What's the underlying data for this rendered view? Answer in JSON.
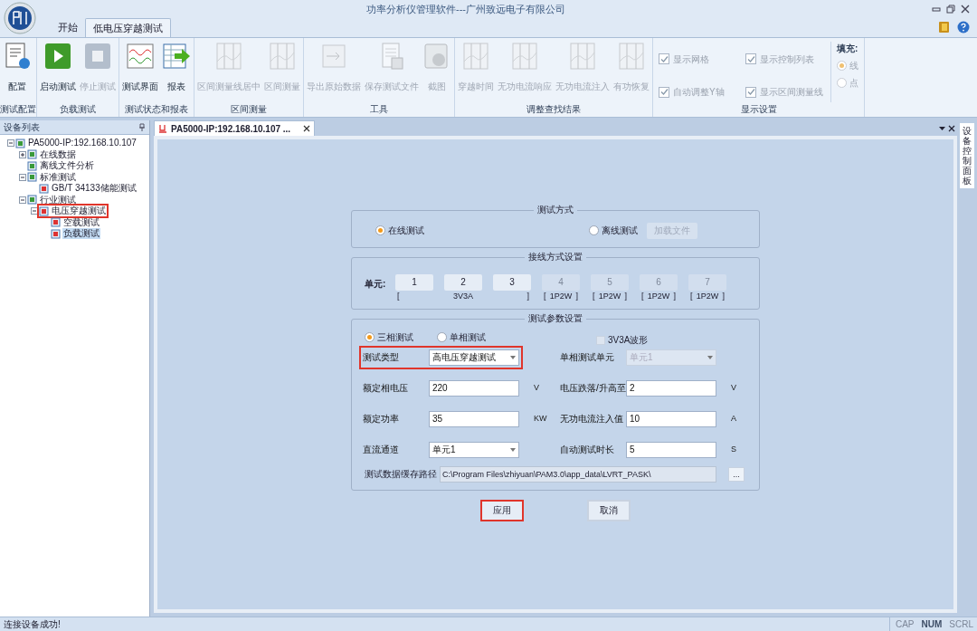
{
  "window": {
    "title": "功率分析仪管理软件---广州致远电子有限公司"
  },
  "ribbon_tabs": [
    {
      "label": "开始",
      "selected": false
    },
    {
      "label": "低电压穿越测试",
      "selected": true
    }
  ],
  "ribbon_groups": [
    {
      "label": "测试配置",
      "buttons": [
        {
          "label": "配置",
          "disabled": false
        }
      ]
    },
    {
      "label": "负载测试",
      "buttons": [
        {
          "label": "启动测试",
          "disabled": false
        },
        {
          "label": "停止测试",
          "disabled": true
        }
      ]
    },
    {
      "label": "测试状态和报表",
      "buttons": [
        {
          "label": "测试界面",
          "disabled": false
        },
        {
          "label": "报表",
          "disabled": false
        }
      ]
    },
    {
      "label": "区间测量",
      "buttons": [
        {
          "label": "区间测量线居中",
          "disabled": true
        },
        {
          "label": "区间测量",
          "disabled": true
        }
      ]
    },
    {
      "label": "工具",
      "buttons": [
        {
          "label": "导出原始数据",
          "disabled": true
        },
        {
          "label": "保存测试文件",
          "disabled": true
        },
        {
          "label": "截图",
          "disabled": true
        }
      ]
    },
    {
      "label": "调整查找结果",
      "buttons": [
        {
          "label": "穿越时间",
          "disabled": true
        },
        {
          "label": "无功电流响应",
          "disabled": true
        },
        {
          "label": "无功电流注入",
          "disabled": true
        },
        {
          "label": "有功恢复",
          "disabled": true
        }
      ]
    }
  ],
  "display_settings": {
    "label": "显示设置",
    "checkboxes": [
      {
        "label": "显示网格",
        "checked": true
      },
      {
        "label": "自动调整Y轴",
        "checked": true
      },
      {
        "label": "显示控制列表",
        "checked": true
      },
      {
        "label": "显示区间测量线",
        "checked": true
      }
    ],
    "fill": {
      "label": "填充:",
      "options": [
        {
          "label": "线",
          "selected": true
        },
        {
          "label": "点",
          "selected": false
        }
      ]
    }
  },
  "device_panel": {
    "title": "设备列表",
    "tree": [
      {
        "label": "PA5000-IP:192.168.10.107",
        "expanded": true,
        "children": [
          {
            "label": "在线数据",
            "expanded": false
          },
          {
            "label": "离线文件分析"
          },
          {
            "label": "标准测试",
            "expanded": true,
            "children": [
              {
                "label": "GB/T 34133储能测试"
              }
            ]
          },
          {
            "label": "行业测试",
            "expanded": true,
            "children": [
              {
                "label": "电压穿越测试",
                "expanded": true,
                "highlighted": true,
                "children": [
                  {
                    "label": "空载测试",
                    "selected": false
                  },
                  {
                    "label": "负载测试",
                    "selected": true
                  }
                ]
              }
            ]
          }
        ]
      }
    ]
  },
  "document_tab": {
    "label": "PA5000-IP:192.168.10.107 ..."
  },
  "side_tab": {
    "label": "设备控制面板"
  },
  "test_mode": {
    "title": "测试方式",
    "options": [
      {
        "label": "在线测试",
        "selected": true
      },
      {
        "label": "离线测试",
        "selected": false
      }
    ],
    "load_file_button": {
      "label": "加载文件",
      "disabled": true
    }
  },
  "wiring": {
    "title": "接线方式设置",
    "label": "单元:",
    "groups": [
      {
        "open": "[",
        "label": "3V3A",
        "close": "]",
        "units": [
          {
            "label": "1",
            "disabled": false
          },
          {
            "label": "2",
            "disabled": false
          },
          {
            "label": "3",
            "disabled": false
          }
        ]
      },
      {
        "open": "[",
        "label": "1P2W",
        "close": "]",
        "units": [
          {
            "label": "4",
            "disabled": true
          }
        ]
      },
      {
        "open": "[",
        "label": "1P2W",
        "close": "]",
        "units": [
          {
            "label": "5",
            "disabled": true
          }
        ]
      },
      {
        "open": "[",
        "label": "1P2W",
        "close": "]",
        "units": [
          {
            "label": "6",
            "disabled": true
          }
        ]
      },
      {
        "open": "[",
        "label": "1P2W",
        "close": "]",
        "units": [
          {
            "label": "7",
            "disabled": true
          }
        ]
      }
    ]
  },
  "params": {
    "title": "测试参数设置",
    "modes": [
      {
        "label": "三相测试",
        "selected": true
      },
      {
        "label": "单相测试",
        "selected": false
      }
    ],
    "waveform_checkbox": {
      "label": "3V3A波形",
      "checked": false
    },
    "rows": [
      {
        "left": {
          "label": "测试类型",
          "value": "高电压穿越测试",
          "kind": "select",
          "highlighted": true
        },
        "right": {
          "label": "单相测试单元",
          "value": "单元1",
          "kind": "select",
          "disabled": true
        }
      },
      {
        "left": {
          "label": "额定相电压",
          "value": "220",
          "kind": "text",
          "unit": "V"
        },
        "right": {
          "label": "电压跌落/升高至",
          "value": "2",
          "kind": "text",
          "unit": "V"
        }
      },
      {
        "left": {
          "label": "额定功率",
          "value": "35",
          "kind": "text",
          "unit": "KW"
        },
        "right": {
          "label": "无功电流注入值",
          "value": "10",
          "kind": "text",
          "unit": "A"
        }
      },
      {
        "left": {
          "label": "直流通道",
          "value": "单元1",
          "kind": "select"
        },
        "right": {
          "label": "自动测试时长",
          "value": "5",
          "kind": "text",
          "unit": "S"
        }
      }
    ],
    "path": {
      "label": "测试数据缓存路径",
      "value": "C:\\Program Files\\zhiyuan\\PAM3.0\\app_data\\LVRT_PASK\\",
      "browse": "..."
    }
  },
  "buttons": [
    {
      "label": "应用",
      "highlighted": true
    },
    {
      "label": "取消",
      "highlighted": false
    }
  ],
  "status_bar": {
    "message": "连接设备成功!",
    "indicators": [
      {
        "label": "CAP",
        "on": false
      },
      {
        "label": "NUM",
        "on": true
      },
      {
        "label": "SCRL",
        "on": false
      }
    ]
  }
}
